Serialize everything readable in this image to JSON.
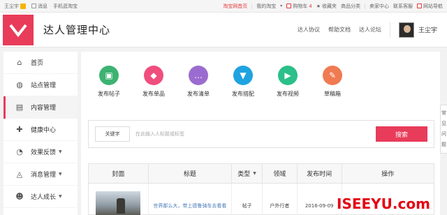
{
  "topbar": {
    "username": "王尘宇",
    "messages": "消息",
    "mobile": "手机逛淘宝",
    "taobao_home": "淘宝网首页",
    "my_taobao": "我的淘宝",
    "cart": "购物车",
    "cart_count": "4",
    "favorites": "收藏夹",
    "categories": "商品分类",
    "seller_center": "卖家中心",
    "contact": "联系客服",
    "site_nav": "网站导航"
  },
  "header": {
    "site_title": "达人管理中心",
    "links": [
      "达人协议",
      "帮助文档",
      "达人论坛"
    ],
    "user_name": "王尘宇"
  },
  "sidebar": {
    "items": [
      {
        "label": "首页",
        "icon": "home-icon",
        "glyph": "⌂"
      },
      {
        "label": "站点管理",
        "icon": "globe-icon",
        "glyph": "◍"
      },
      {
        "label": "内容管理",
        "icon": "document-icon",
        "glyph": "▤"
      },
      {
        "label": "健康中心",
        "icon": "plus-icon",
        "glyph": "✚"
      },
      {
        "label": "效果反馈",
        "icon": "chart-icon",
        "glyph": "◔",
        "caret": "▼"
      },
      {
        "label": "消息管理",
        "icon": "bell-icon",
        "glyph": "◬",
        "caret": "▼"
      },
      {
        "label": "达人成长",
        "icon": "user-icon",
        "glyph": "☻",
        "caret": "▼"
      }
    ],
    "active_index": 2
  },
  "quick_actions": [
    {
      "label": "发布帖子",
      "icon": "image-icon",
      "color": "#3cb371",
      "glyph": "▣"
    },
    {
      "label": "发布单品",
      "icon": "tag-icon",
      "color": "#f04e7d",
      "glyph": "◆"
    },
    {
      "label": "发布清单",
      "icon": "list-icon",
      "color": "#9b6ccf",
      "glyph": "…"
    },
    {
      "label": "发布搭配",
      "icon": "shirt-icon",
      "color": "#1fa3e0",
      "glyph": "▼"
    },
    {
      "label": "发布视频",
      "icon": "play-icon",
      "color": "#2bbf8a",
      "glyph": "▶"
    },
    {
      "label": "草稿箱",
      "icon": "eraser-icon",
      "color": "#f07a52",
      "glyph": "✎"
    }
  ],
  "search": {
    "keyword_label": "关键字",
    "placeholder": "在此输入人标题或标签",
    "button_label": "搜索"
  },
  "table": {
    "headers": [
      "封面",
      "标题",
      "类型",
      "领域",
      "发布时间",
      "操作"
    ],
    "type_caret": "▼",
    "rows": [
      {
        "title": "世界那么大，带上德鲁骑车去看看",
        "type": "帖子",
        "domain": "户外行者",
        "date": "2016-09-09"
      }
    ]
  },
  "float_tab": [
    "常",
    "见",
    "问",
    "题"
  ],
  "watermark": {
    "text": "ISEEYU.com"
  },
  "colors": {
    "accent": "#e83c5a",
    "link": "#4a7bb7"
  }
}
